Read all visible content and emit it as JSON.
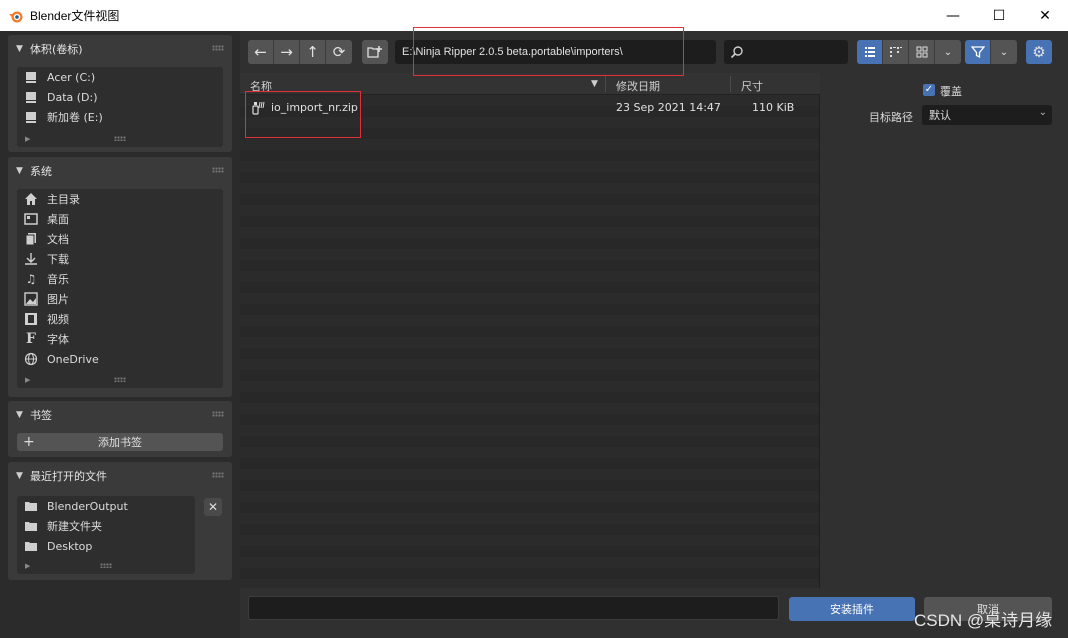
{
  "window": {
    "title": "Blender文件视图",
    "controls": {
      "minimize": "—",
      "maximize": "☐",
      "close": "✕"
    }
  },
  "sidebar": {
    "volumes": {
      "title": "体积(卷标)",
      "items": [
        {
          "label": "Acer (C:)",
          "icon": "drive-icon"
        },
        {
          "label": "Data (D:)",
          "icon": "drive-icon"
        },
        {
          "label": "新加卷 (E:)",
          "icon": "drive-icon"
        }
      ]
    },
    "system": {
      "title": "系统",
      "items": [
        {
          "label": "主目录",
          "icon": "home-icon"
        },
        {
          "label": "桌面",
          "icon": "desktop-icon"
        },
        {
          "label": "文档",
          "icon": "documents-icon"
        },
        {
          "label": "下载",
          "icon": "download-icon"
        },
        {
          "label": "音乐",
          "icon": "music-icon"
        },
        {
          "label": "图片",
          "icon": "image-icon"
        },
        {
          "label": "视频",
          "icon": "video-icon"
        },
        {
          "label": "字体",
          "icon": "font-icon"
        },
        {
          "label": "OneDrive",
          "icon": "globe-icon"
        }
      ]
    },
    "bookmarks": {
      "title": "书签",
      "add_label": "添加书签"
    },
    "recent": {
      "title": "最近打开的文件",
      "items": [
        {
          "label": "BlenderOutput",
          "icon": "folder-icon"
        },
        {
          "label": "新建文件夹",
          "icon": "folder-icon"
        },
        {
          "label": "Desktop",
          "icon": "folder-icon"
        }
      ]
    }
  },
  "toolbar": {
    "path": "E:\\Ninja Ripper 2.0.5 beta.portable\\importers\\",
    "search_value": ""
  },
  "filelist": {
    "columns": {
      "name": "名称",
      "date": "修改日期",
      "size": "尺寸"
    },
    "rows": [
      {
        "name": "io_import_nr.zip",
        "date": "23 Sep 2021 14:47",
        "size": "110 KiB"
      }
    ]
  },
  "options": {
    "overwrite_label": "覆盖",
    "overwrite_checked": true,
    "target_path_label": "目标路径",
    "target_path_value": "默认"
  },
  "bottom": {
    "filename_value": "",
    "install_label": "安装插件",
    "cancel_label": "取消"
  },
  "watermark": "CSDN @桌诗月缘",
  "colors": {
    "accent": "#4772b3",
    "highlight_box": "#e0303a"
  }
}
